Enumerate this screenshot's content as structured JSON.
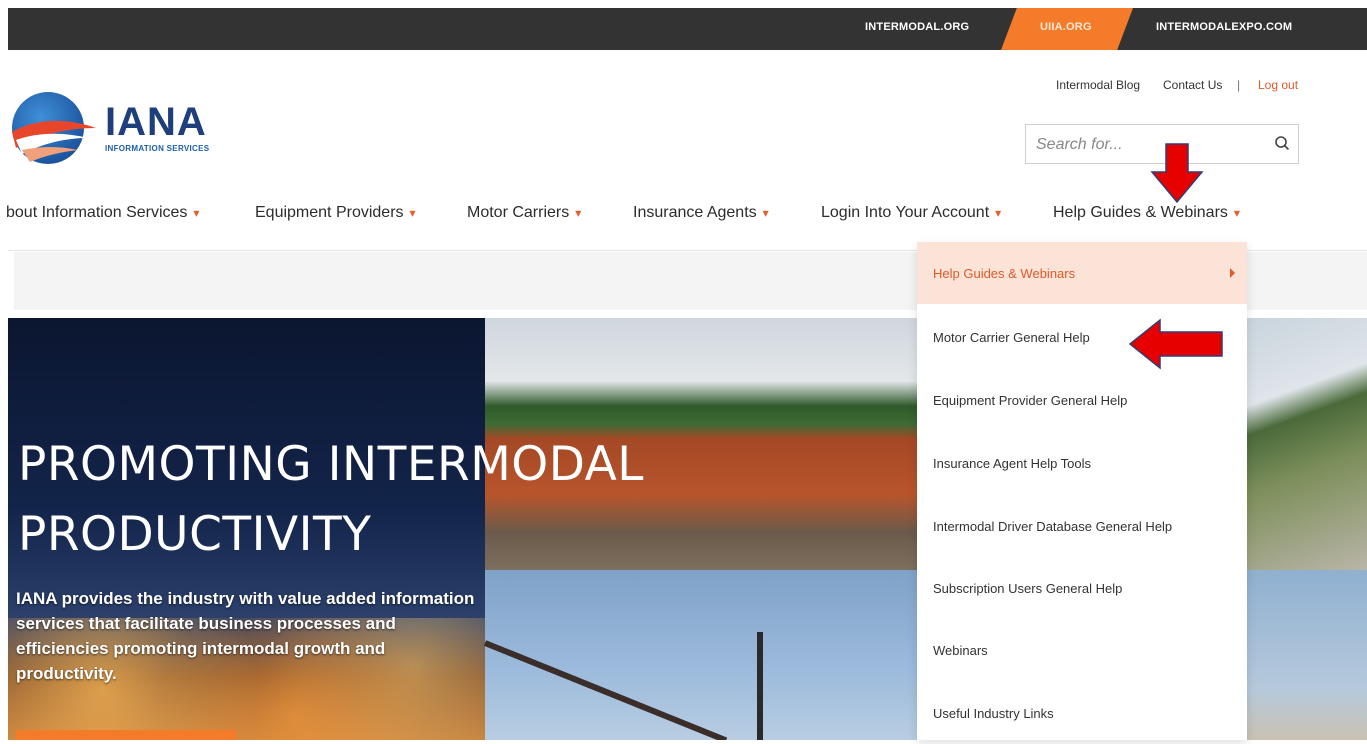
{
  "top_links": [
    "INTERMODAL.ORG",
    "UIIA.ORG",
    "INTERMODALEXPO.COM"
  ],
  "logo": {
    "name": "IANA",
    "subtitle": "INFORMATION SERVICES"
  },
  "util_links": {
    "blog": "Intermodal Blog",
    "contact": "Contact Us",
    "separator": "|",
    "logout": "Log out"
  },
  "search": {
    "placeholder": "Search for..."
  },
  "nav": [
    {
      "label": "bout Information Services"
    },
    {
      "label": "Equipment Providers"
    },
    {
      "label": "Motor Carriers"
    },
    {
      "label": "Insurance Agents"
    },
    {
      "label": "Login Into Your Account"
    },
    {
      "label": "Help Guides & Webinars"
    }
  ],
  "hero": {
    "title_line1": "PROMOTING INTERMODAL",
    "title_line2": "PRODUCTIVITY",
    "body": "IANA provides the industry with value added information services that facilitate business processes and efficiencies promoting intermodal growth and productivity."
  },
  "dropdown": {
    "items": [
      "Help Guides & Webinars",
      "Motor Carrier General Help",
      "Equipment Provider General Help",
      "Insurance Agent Help Tools",
      "Intermodal Driver Database General Help",
      "Subscription Users General Help",
      "Webinars",
      "Useful Industry Links"
    ]
  },
  "colors": {
    "accent": "#f47b2a",
    "topbar": "#333333",
    "brand_blue": "#1f3e7c",
    "annotation_red": "#e60000",
    "menu_active_bg": "#fbe3d7"
  },
  "icons": [
    "search-icon",
    "caret-down-icon",
    "submenu-arrow-icon",
    "annotation-arrow-down",
    "annotation-arrow-left"
  ]
}
